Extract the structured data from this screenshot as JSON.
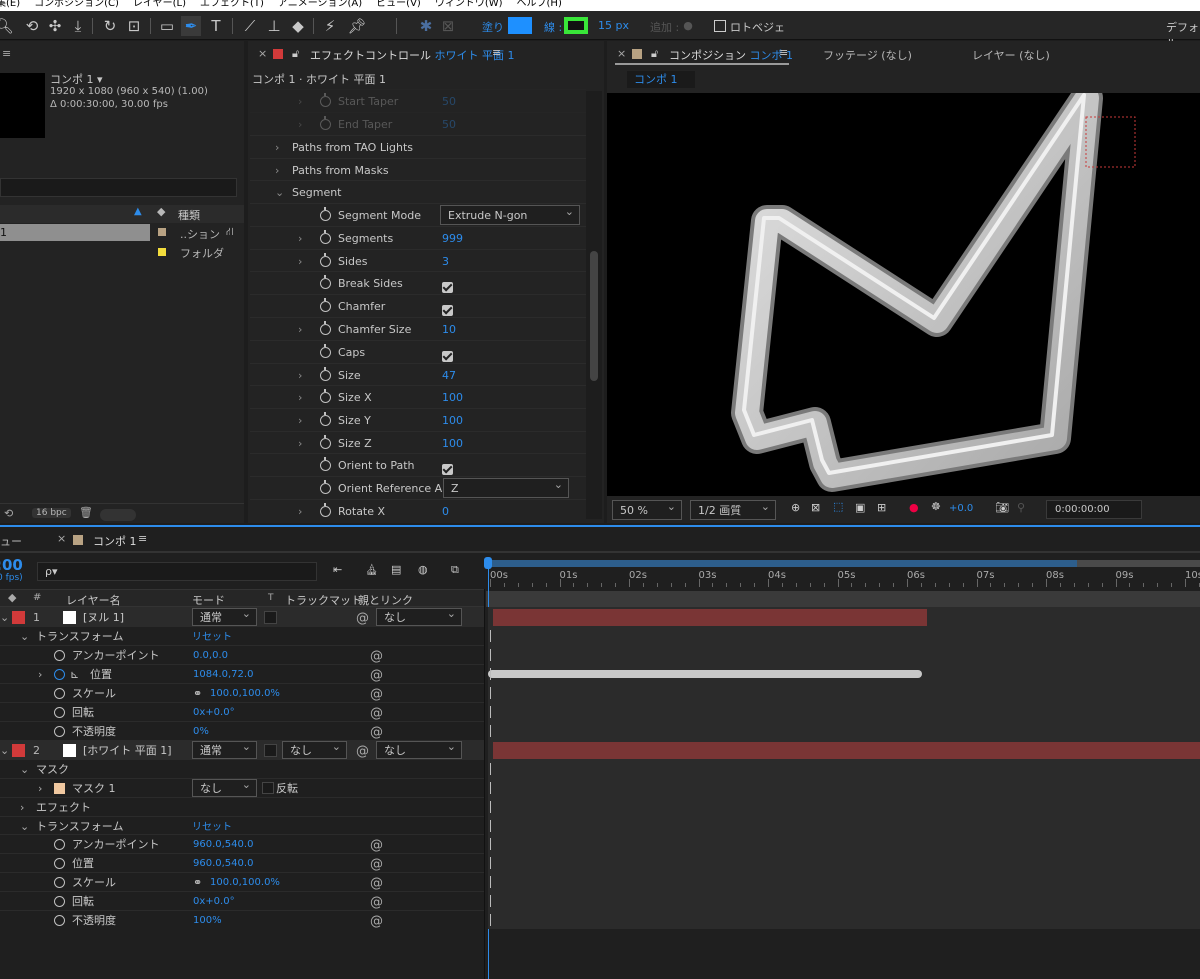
{
  "menu": [
    "集(E)",
    "コンポジション(C)",
    "レイヤー(L)",
    "エフェクト(T)",
    "アニメーション(A)",
    "ビュー(V)",
    "ウィンドウ(W)",
    "ヘルプ(H)"
  ],
  "toolbar": {
    "fill_label": "塗り :",
    "stroke_label": "線 :",
    "stroke_px": "15 px",
    "add_label": "追加 :",
    "bezier_label": "ロトベジェ",
    "workspace": "デフォル",
    "fill_color": "#1e90ff",
    "stroke_color": "#39e639"
  },
  "project": {
    "comp_name": "コンポ 1 ▾",
    "comp_info": "1920 x 1080 (960 x 540) (1.00)",
    "comp_duration": "Δ 0:00:30:00, 30.00 fps",
    "col_type": "種類",
    "items": [
      {
        "num": "1",
        "type": "..ション"
      },
      {
        "type": "フォルダ"
      }
    ],
    "bpc": "16 bpc"
  },
  "effects": {
    "tab_label": "エフェクトコントロール",
    "tab_layer": "ホワイト 平面 1",
    "breadcrumb": "コンポ 1 · ホワイト 平面 1",
    "rows": [
      {
        "name": "Start Taper",
        "value": "50"
      },
      {
        "name": "End Taper",
        "value": "50"
      },
      {
        "name": "Paths from TAO Lights"
      },
      {
        "name": "Paths from Masks"
      },
      {
        "name": "Segment"
      },
      {
        "name": "Segment Mode",
        "value": "Extrude N-gon"
      },
      {
        "name": "Segments",
        "value": "999"
      },
      {
        "name": "Sides",
        "value": "3"
      },
      {
        "name": "Break Sides"
      },
      {
        "name": "Chamfer"
      },
      {
        "name": "Chamfer Size",
        "value": "10"
      },
      {
        "name": "Caps"
      },
      {
        "name": "Size",
        "value": "47"
      },
      {
        "name": "Size X",
        "value": "100"
      },
      {
        "name": "Size Y",
        "value": "100"
      },
      {
        "name": "Size Z",
        "value": "100"
      },
      {
        "name": "Orient to Path"
      },
      {
        "name": "Orient Reference A",
        "value": "Z"
      },
      {
        "name": "Rotate X",
        "value": "0"
      }
    ]
  },
  "viewer": {
    "tab_label": "コンポジション",
    "tab_comp": "コンポ 1",
    "footage_tab": "フッテージ (なし)",
    "layer_tab": "レイヤー (なし)",
    "subtab": "コンポ 1",
    "zoom": "50 %",
    "quality": "1/2 画質",
    "exposure": "+0.0",
    "timecode": "0:00:00:00"
  },
  "timeline": {
    "left_tab": "ュー",
    "tab": "コンポ 1",
    "timecode": ":00",
    "fps": "0 fps)",
    "search_placeholder": "ρ▾",
    "headers": {
      "layer_name": "レイヤー名",
      "mode": "モード",
      "t": "T",
      "track_matte": "トラックマット",
      "parent": "親とリンク"
    },
    "ruler": [
      "00s",
      "01s",
      "02s",
      "03s",
      "04s",
      "05s",
      "06s",
      "07s",
      "08s",
      "09s",
      "10s"
    ],
    "layer1": {
      "num": "1",
      "name": "[ヌル 1]",
      "mode": "通常",
      "parent": "なし"
    },
    "transform_label": "トランスフォーム",
    "reset_label": "リセット",
    "layer1_props": [
      {
        "name": "アンカーポイント",
        "value": "0.0,0.0"
      },
      {
        "name": "位置",
        "value": "1084.0,72.0"
      },
      {
        "name": "スケール",
        "value": "100.0,100.0%"
      },
      {
        "name": "回転",
        "value": "0x+0.0°"
      },
      {
        "name": "不透明度",
        "value": "0%"
      }
    ],
    "layer2": {
      "num": "2",
      "name": "[ホワイト 平面 1]",
      "mode": "通常",
      "matte": "なし",
      "parent": "なし"
    },
    "mask_label": "マスク",
    "mask1_label": "マスク 1",
    "mask_mode": "なし",
    "mask_invert": "反転",
    "effect_label": "エフェクト",
    "layer2_props": [
      {
        "name": "アンカーポイント",
        "value": "960.0,540.0"
      },
      {
        "name": "位置",
        "value": "960.0,540.0"
      },
      {
        "name": "スケール",
        "value": "100.0,100.0%"
      },
      {
        "name": "回転",
        "value": "0x+0.0°"
      },
      {
        "name": "不透明度",
        "value": "100%"
      }
    ],
    "layer1_bar_end_fraction": 0.61,
    "work_area_end_fraction": 0.83,
    "position_keyframe_bar_end_fraction": 0.61
  }
}
